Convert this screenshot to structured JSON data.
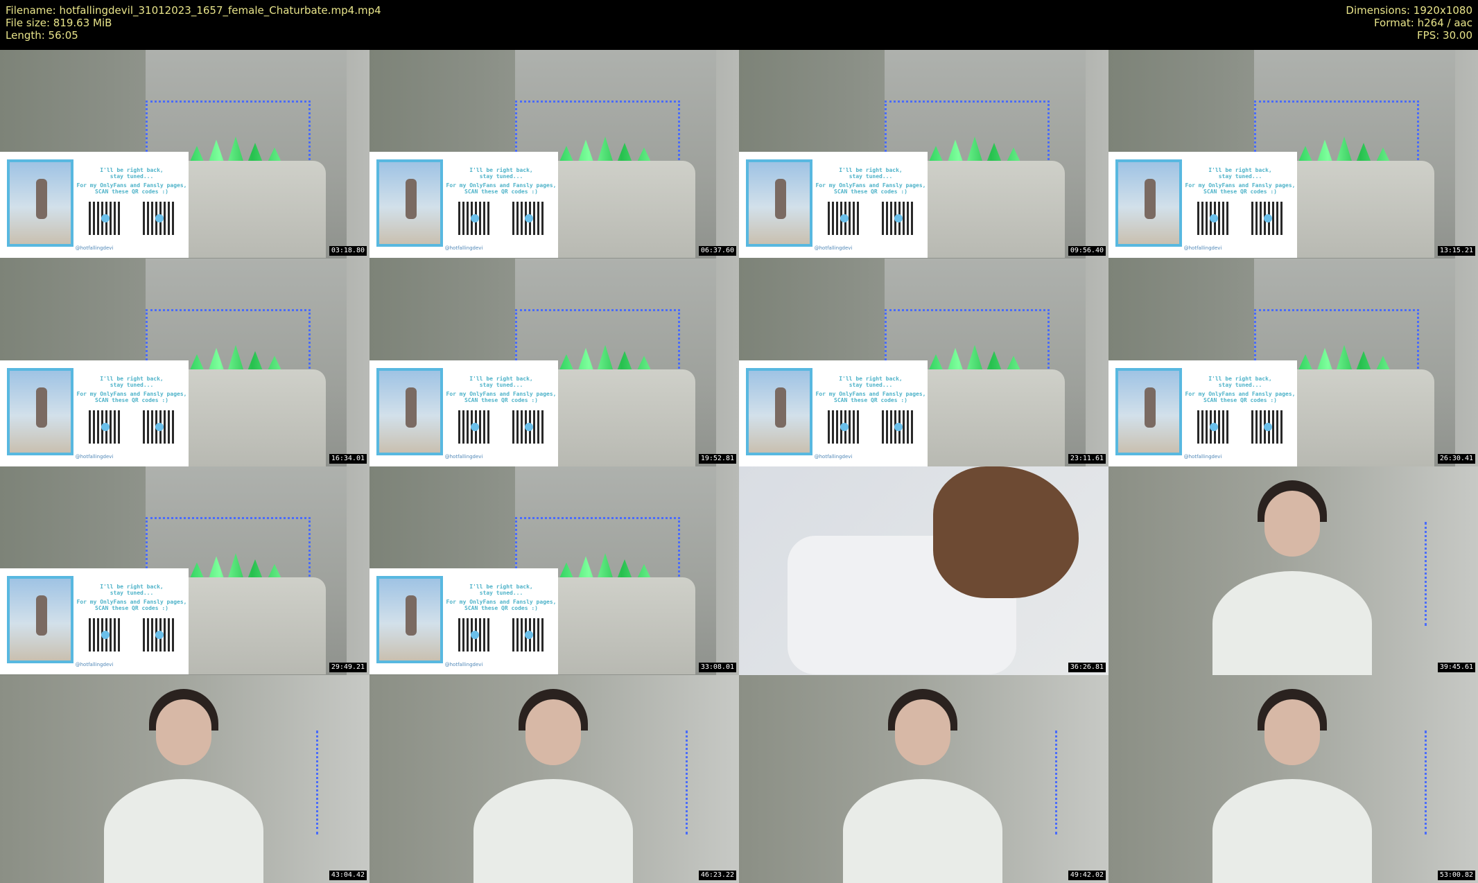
{
  "header": {
    "filename_line": "Filename: hotfallingdevil_31012023_1657_female_Chaturbate.mp4.mp4",
    "filesize_line": "File size: 819.63 MiB",
    "length_line": "Length: 56:05",
    "dimensions_line": "Dimensions: 1920x1080",
    "format_line": "Format: h264 / aac",
    "fps_line": "FPS: 30.00"
  },
  "brb_card": {
    "line1": "I'll be right back,",
    "line2": "stay tuned...",
    "line3": "For my OnlyFans and Fansly pages,",
    "line4": "SCAN these QR codes :)",
    "handle": "@hotfallingdevi"
  },
  "thumbnails": [
    {
      "kind": "brb",
      "timestamp": "03:18.80"
    },
    {
      "kind": "brb",
      "timestamp": "06:37.60"
    },
    {
      "kind": "brb",
      "timestamp": "09:56.40"
    },
    {
      "kind": "brb",
      "timestamp": "13:15.21"
    },
    {
      "kind": "brb",
      "timestamp": "16:34.01"
    },
    {
      "kind": "brb",
      "timestamp": "19:52.81"
    },
    {
      "kind": "brb",
      "timestamp": "23:11.61"
    },
    {
      "kind": "brb",
      "timestamp": "26:30.41"
    },
    {
      "kind": "brb",
      "timestamp": "29:49.21"
    },
    {
      "kind": "brb",
      "timestamp": "33:08.01"
    },
    {
      "kind": "bend",
      "timestamp": "36:26.81"
    },
    {
      "kind": "person",
      "timestamp": "39:45.61"
    },
    {
      "kind": "person",
      "timestamp": "43:04.42"
    },
    {
      "kind": "person",
      "timestamp": "46:23.22"
    },
    {
      "kind": "person",
      "timestamp": "49:42.02"
    },
    {
      "kind": "person",
      "timestamp": "53:00.82"
    }
  ]
}
